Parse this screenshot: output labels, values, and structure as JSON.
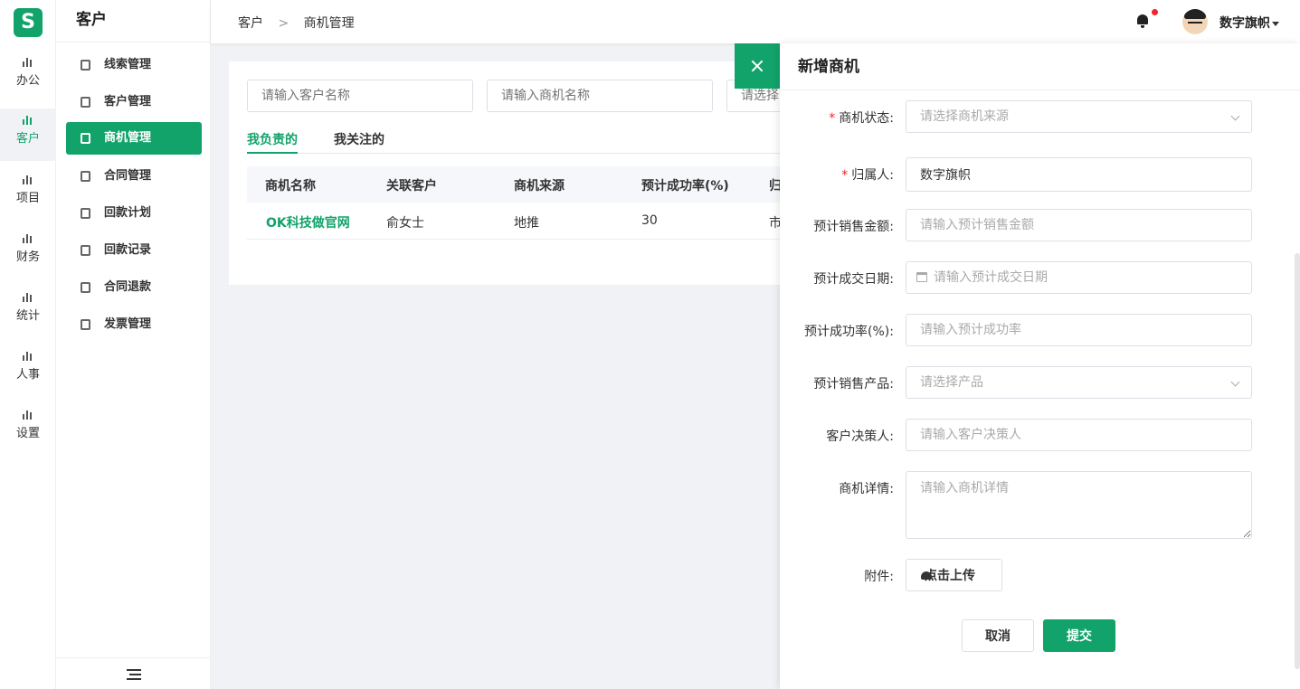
{
  "app": {
    "logo": "S"
  },
  "rail": [
    {
      "label": "办公",
      "active": false
    },
    {
      "label": "客户",
      "active": true
    },
    {
      "label": "项目",
      "active": false
    },
    {
      "label": "财务",
      "active": false
    },
    {
      "label": "统计",
      "active": false
    },
    {
      "label": "人事",
      "active": false
    },
    {
      "label": "设置",
      "active": false
    }
  ],
  "subnav": {
    "title": "客户",
    "items": [
      {
        "label": "线索管理",
        "icon": "leads-icon"
      },
      {
        "label": "客户管理",
        "icon": "customers-icon"
      },
      {
        "label": "商机管理",
        "icon": "briefcase-icon",
        "active": true
      },
      {
        "label": "合同管理",
        "icon": "contract-icon"
      },
      {
        "label": "回款计划",
        "icon": "payment-plan-icon"
      },
      {
        "label": "回款记录",
        "icon": "payment-record-icon"
      },
      {
        "label": "合同退款",
        "icon": "refund-icon"
      },
      {
        "label": "发票管理",
        "icon": "invoice-icon"
      }
    ]
  },
  "header": {
    "breadcrumb": [
      "客户",
      "商机管理"
    ],
    "breadcrumb_sep": ">",
    "username": "数字旗帜"
  },
  "main": {
    "search": {
      "customer_placeholder": "请输入客户名称",
      "opportunity_placeholder": "请输入商机名称",
      "third_placeholder": "请选择"
    },
    "tabs": [
      "我负责的",
      "我关注的"
    ],
    "table": {
      "columns": [
        "商机名称",
        "关联客户",
        "商机来源",
        "预计成功率(%)",
        "归"
      ],
      "rows": [
        [
          "OK科技做官网",
          "俞女士",
          "地推",
          "30",
          "市"
        ]
      ]
    }
  },
  "drawer": {
    "title": "新增商机",
    "fields": {
      "status": {
        "label": "商机状态:",
        "placeholder": "请选择商机来源",
        "required": "*"
      },
      "owner": {
        "label": "归属人:",
        "value": "数字旗帜",
        "required": "*"
      },
      "amount": {
        "label": "预计销售金额:",
        "placeholder": "请输入预计销售金额"
      },
      "date": {
        "label": "预计成交日期:",
        "placeholder": "请输入预计成交日期"
      },
      "rate": {
        "label": "预计成功率(%):",
        "placeholder": "请输入预计成功率"
      },
      "product": {
        "label": "预计销售产品:",
        "placeholder": "请选择产品"
      },
      "decision_maker": {
        "label": "客户决策人:",
        "placeholder": "请输入客户决策人"
      },
      "details": {
        "label": "商机详情:",
        "placeholder": "请输入商机详情"
      },
      "attachment": {
        "label": "附件:",
        "button": "点击上传"
      }
    },
    "cancel": "取消",
    "submit": "提交"
  },
  "colors": {
    "accent": "#12a36a",
    "danger": "#f5222d"
  }
}
